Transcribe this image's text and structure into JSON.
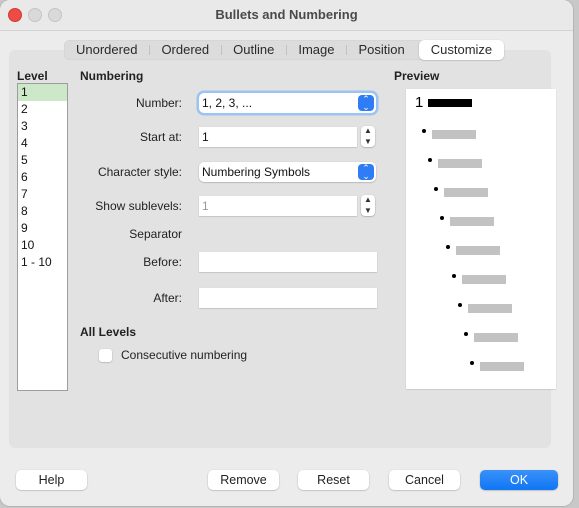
{
  "window": {
    "title": "Bullets and Numbering"
  },
  "tabs": [
    {
      "label": "Unordered",
      "active": false
    },
    {
      "label": "Ordered",
      "active": false
    },
    {
      "label": "Outline",
      "active": false
    },
    {
      "label": "Image",
      "active": false
    },
    {
      "label": "Position",
      "active": false
    },
    {
      "label": "Customize",
      "active": true
    }
  ],
  "level": {
    "heading": "Level",
    "items": [
      "1",
      "2",
      "3",
      "4",
      "5",
      "6",
      "7",
      "8",
      "9",
      "10",
      "1 - 10"
    ],
    "selected": "1"
  },
  "numbering": {
    "heading": "Numbering",
    "number_label": "Number:",
    "number_value": "1, 2, 3, ...",
    "start_label": "Start at:",
    "start_value": "1",
    "charstyle_label": "Character style:",
    "charstyle_value": "Numbering Symbols",
    "sublevels_label": "Show sublevels:",
    "sublevels_value": "1",
    "separator_label": "Separator",
    "before_label": "Before:",
    "before_value": "",
    "after_label": "After:",
    "after_value": ""
  },
  "all_levels": {
    "heading": "All Levels",
    "consecutive_label": "Consecutive numbering",
    "consecutive_checked": false
  },
  "preview": {
    "heading": "Preview",
    "first_number": "1"
  },
  "icons": {
    "stepper_up": "▲",
    "stepper_down": "▼",
    "select_up": "⌃",
    "select_down": "⌄"
  },
  "buttons": {
    "help": "Help",
    "remove": "Remove",
    "reset": "Reset",
    "cancel": "Cancel",
    "ok": "OK"
  },
  "colors": {
    "accent": "#1a7ff6",
    "selected_level": "#cde8c8",
    "close": "#ee4b45"
  }
}
